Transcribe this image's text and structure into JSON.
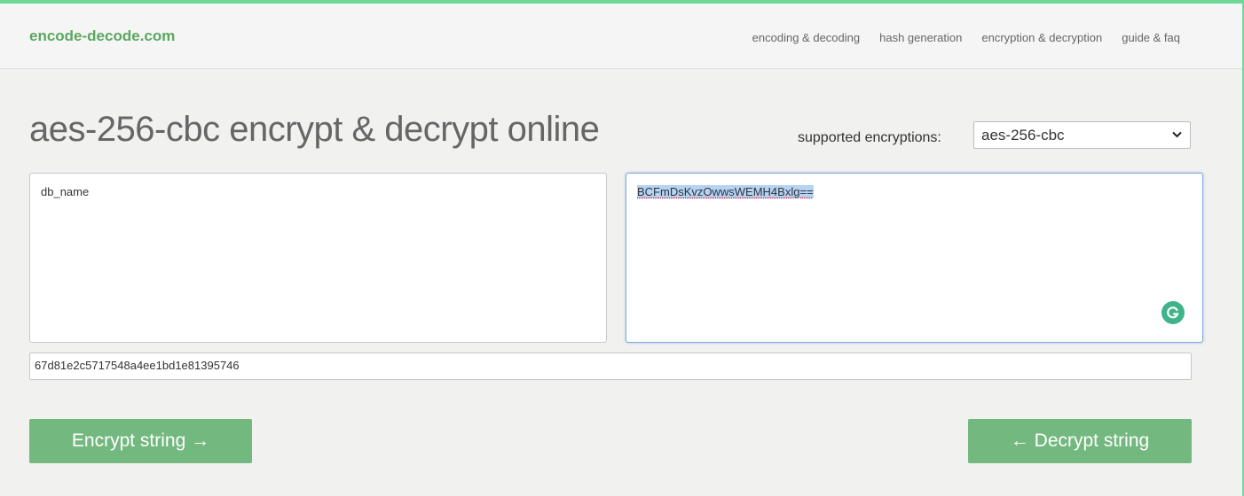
{
  "header": {
    "logo": "encode-decode.com",
    "nav": [
      "encoding & decoding",
      "hash generation",
      "encryption & decryption",
      "guide & faq"
    ]
  },
  "main": {
    "title": "aes-256-cbc encrypt & decrypt online",
    "encryption_label": "supported encryptions:",
    "encryption_selected": "aes-256-cbc",
    "input_text": "db_name",
    "output_text": "BCFmDsKvzOwwsWEMH4Bxlg==",
    "key_value": "67d81e2c5717548a4ee1bd1e81395746",
    "encrypt_button": "Encrypt string →",
    "decrypt_button": "← Decrypt string"
  },
  "colors": {
    "brand": "#5aa85f",
    "button": "#73b87e",
    "accent_bar": "#6fd898",
    "selection": "#b5d3f5"
  },
  "icons": {
    "dropdown": "chevron-down-icon",
    "grammar": "grammarly-icon"
  }
}
